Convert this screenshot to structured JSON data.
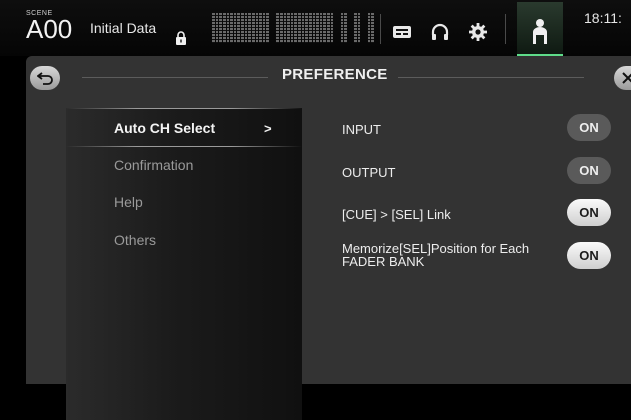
{
  "topbar": {
    "scene_tag": "SCENE",
    "scene_number": "A00",
    "scene_name": "Initial Data",
    "clock": "18:11:"
  },
  "panel": {
    "title": "PREFERENCE"
  },
  "menu": {
    "items": [
      {
        "label": "Auto CH Select",
        "active": true
      },
      {
        "label": "Confirmation",
        "active": false
      },
      {
        "label": "Help",
        "active": false
      },
      {
        "label": "Others",
        "active": false
      }
    ],
    "active_arrow": ">"
  },
  "settings": [
    {
      "label": "INPUT",
      "toggle": "ON",
      "state": "dim"
    },
    {
      "label": "OUTPUT",
      "toggle": "ON",
      "state": "dim"
    },
    {
      "label": "[CUE] > [SEL] Link",
      "toggle": "ON",
      "state": "bright"
    },
    {
      "label": "Memorize[SEL]Position for Each FADER BANK",
      "toggle": "ON",
      "state": "bright"
    }
  ],
  "icons": {
    "lock": "lock-icon",
    "library": "library-icon",
    "monitor": "headphones-icon",
    "setup": "gear-icon",
    "user": "user-icon",
    "back": "back-arrow-icon",
    "close": "close-icon"
  },
  "colors": {
    "accent": "#5fdc8a",
    "panel_bg": "#333333",
    "toggle_dim": "#5a5a5a",
    "toggle_bright": "#f0f0f0"
  }
}
